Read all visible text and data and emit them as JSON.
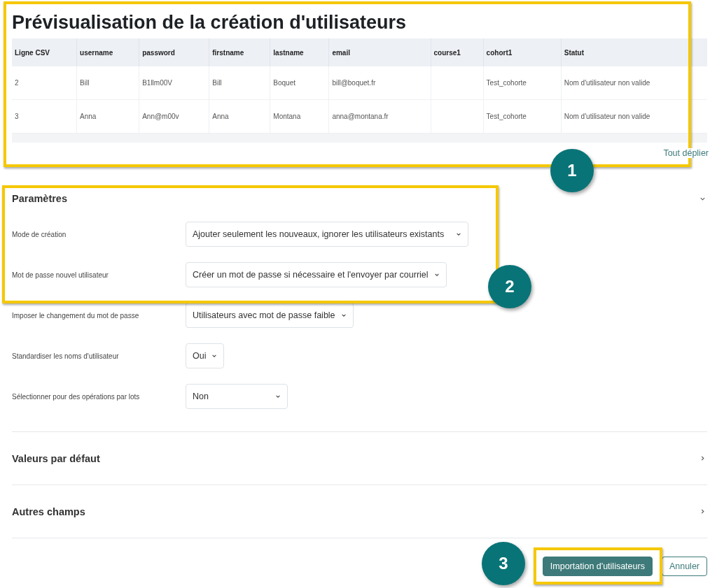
{
  "title": "Prévisualisation de la création d'utilisateurs",
  "table": {
    "columns": [
      "Ligne CSV",
      "username",
      "password",
      "firstname",
      "lastname",
      "email",
      "course1",
      "cohort1",
      "Statut"
    ],
    "rows": [
      [
        "2",
        "Bill",
        "B1llm00V",
        "Bill",
        "Boquet",
        "bill@boquet.fr",
        "",
        "Test_cohorte",
        "Nom d'utilisateur non valide"
      ],
      [
        "3",
        "Anna",
        "Ann@m00v",
        "Anna",
        "Montana",
        "anna@montana.fr",
        "",
        "Test_cohorte",
        "Nom d'utilisateur non valide"
      ]
    ]
  },
  "expand_all_link": "Tout déplier",
  "sections": [
    {
      "title": "Paramètres",
      "expanded": true,
      "fields": [
        {
          "label": "Mode de création",
          "value": "Ajouter seulement les nouveaux, ignorer les utilisateurs existants"
        },
        {
          "label": "Mot de passe nouvel utilisateur",
          "value": "Créer un mot de passe si nécessaire et l'envoyer par courriel"
        },
        {
          "label": "Imposer le changement du mot de passe",
          "value": "Utilisateurs avec mot de passe faible"
        },
        {
          "label": "Standardiser les noms d'utilisateur",
          "value": "Oui"
        },
        {
          "label": "Sélectionner pour des opérations par lots",
          "value": "Non"
        }
      ]
    },
    {
      "title": "Valeurs par défaut",
      "expanded": false
    },
    {
      "title": "Autres champs",
      "expanded": false
    }
  ],
  "buttons": [
    {
      "label": "Importation d'utilisateurs",
      "kind": "primary"
    },
    {
      "label": "Annuler",
      "kind": "secondary"
    }
  ],
  "callouts": [
    "1",
    "2",
    "3"
  ]
}
